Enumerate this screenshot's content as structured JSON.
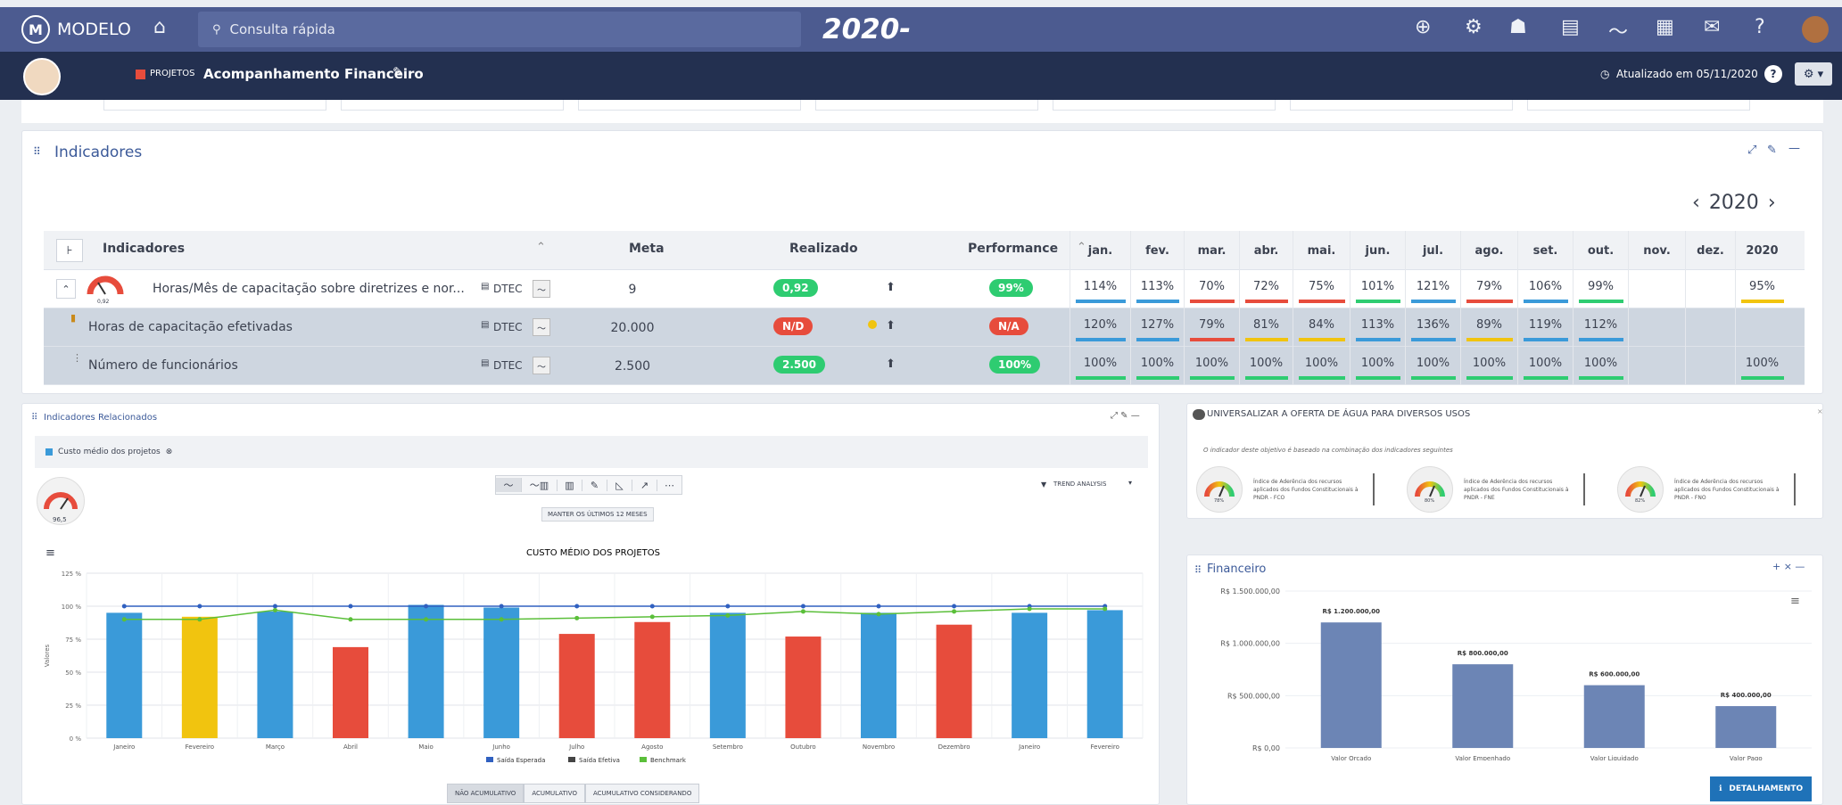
{
  "app": {
    "brand": "MODELO",
    "year_center": "2020-",
    "search_placeholder": "Consulta rápida"
  },
  "sub": {
    "badge": "PROJETOS",
    "title": "Acompanhamento Financeiro",
    "updated": "Atualizado em 05/11/2020"
  },
  "indicadores": {
    "title": "Indicadores",
    "year": "2020",
    "headers": {
      "ind": "Indicadores",
      "meta": "Meta",
      "real": "Realizado",
      "perf": "Performance"
    },
    "months": [
      "jan.",
      "fev.",
      "mar.",
      "abr.",
      "mai.",
      "jun.",
      "jul.",
      "ago.",
      "set.",
      "out.",
      "nov.",
      "dez.",
      "2020"
    ],
    "gauge_value": "0,92",
    "rows": [
      {
        "name": "Horas/Mês de capacitação sobre diretrizes e nor...",
        "dept": "DTEC",
        "meta": "9",
        "real": "0,92",
        "perf": "99%",
        "vals": [
          "114%",
          "113%",
          "70%",
          "72%",
          "75%",
          "101%",
          "121%",
          "79%",
          "106%",
          "99%",
          "",
          "",
          "95%"
        ],
        "colors": [
          "blue",
          "blue",
          "red",
          "red",
          "red",
          "green",
          "blue",
          "red",
          "blue",
          "green",
          "",
          "",
          "yellow"
        ]
      },
      {
        "name": "Horas de capacitação efetivadas",
        "dept": "DTEC",
        "meta": "20.000",
        "real": "N/D",
        "perf": "N/A",
        "vals": [
          "120%",
          "127%",
          "79%",
          "81%",
          "84%",
          "113%",
          "136%",
          "89%",
          "119%",
          "112%",
          "",
          "",
          ""
        ],
        "colors": [
          "blue",
          "blue",
          "red",
          "yellow",
          "yellow",
          "blue",
          "blue",
          "yellow",
          "blue",
          "blue",
          "",
          "",
          ""
        ]
      },
      {
        "name": "Número de funcionários",
        "dept": "DTEC",
        "meta": "2.500",
        "real": "2.500",
        "perf": "100%",
        "vals": [
          "100%",
          "100%",
          "100%",
          "100%",
          "100%",
          "100%",
          "100%",
          "100%",
          "100%",
          "100%",
          "",
          "",
          "100%"
        ],
        "colors": [
          "green",
          "green",
          "green",
          "green",
          "green",
          "green",
          "green",
          "green",
          "green",
          "green",
          "",
          "",
          "green"
        ]
      }
    ]
  },
  "rel": {
    "title": "Indicadores Relacionados",
    "filter": "Custo médio dos projetos",
    "gauge": "96,5",
    "series_btn": "MANTER OS ÚLTIMOS 12 MESES",
    "trend": "TREND ANALYSIS",
    "modes": [
      "NÃO ACUMULATIVO",
      "ACUMULATIVO",
      "ACUMULATIVO CONSIDERANDO"
    ]
  },
  "chart_data": [
    {
      "type": "bar",
      "title": "CUSTO MÉDIO DOS PROJETOS",
      "ylabel": "Valores",
      "ylim": [
        0,
        125
      ],
      "yticks": [
        "0 %",
        "25 %",
        "50 %",
        "75 %",
        "100 %",
        "125 %"
      ],
      "categories": [
        "Janeiro",
        "Fevereiro",
        "Março",
        "Abril",
        "Maio",
        "Junho",
        "Julho",
        "Agosto",
        "Setembro",
        "Outubro",
        "Novembro",
        "Dezembro",
        "Janeiro",
        "Fevereiro"
      ],
      "series": [
        {
          "name": "Saída Esperada",
          "type": "line",
          "color": "#3060c0",
          "values": [
            100,
            100,
            100,
            100,
            100,
            100,
            100,
            100,
            100,
            100,
            100,
            100,
            100,
            100
          ]
        },
        {
          "name": "Saída Efetiva",
          "type": "bar",
          "values": [
            95,
            92,
            96,
            69,
            101,
            99,
            79,
            88,
            95,
            77,
            95,
            86,
            95,
            97
          ],
          "colors": [
            "#3a9ad9",
            "#f1c40f",
            "#3a9ad9",
            "#e74c3c",
            "#3a9ad9",
            "#3a9ad9",
            "#e74c3c",
            "#e74c3c",
            "#3a9ad9",
            "#e74c3c",
            "#3a9ad9",
            "#e74c3c",
            "#3a9ad9",
            "#3a9ad9"
          ]
        },
        {
          "name": "Benchmark",
          "type": "line",
          "color": "#5bbf3a",
          "values": [
            90,
            90,
            97,
            90,
            90,
            90,
            91,
            92,
            93,
            96,
            94,
            96,
            98,
            98
          ]
        }
      ]
    },
    {
      "type": "bar",
      "title": "Financeiro",
      "ylim": [
        0,
        1500000
      ],
      "yticks": [
        "R$ 0,00",
        "R$ 500.000,00",
        "R$ 1.000.000,00",
        "R$ 1.500.000,00"
      ],
      "categories": [
        "Valor Orçado",
        "Valor Empenhado",
        "Valor Liquidado",
        "Valor Pago"
      ],
      "values": [
        1200000,
        800000,
        600000,
        400000
      ],
      "labels": [
        "R$ 1.200.000,00",
        "R$ 800.000,00",
        "R$ 600.000,00",
        "R$ 400.000,00"
      ]
    }
  ],
  "univ": {
    "title": "UNIVERSALIZAR A OFERTA DE ÁGUA PARA DIVERSOS USOS",
    "note": "O indicador deste objetivo é baseado na combinação dos indicadores seguintes",
    "items": [
      {
        "g": "78%",
        "t": "Índice de Aderência dos recursos aplicados dos Fundos Constitucionais à PNDR - FCO"
      },
      {
        "g": "80%",
        "t": "Índice de Aderência dos recursos aplicados dos Fundos Constitucionais à PNDR - FNE"
      },
      {
        "g": "82%",
        "t": "Índice de Aderência dos recursos aplicados dos Fundos Constitucionais à PNDR - FNO"
      }
    ]
  },
  "fin": {
    "title": "Financeiro",
    "detail": "DETALHAMENTO"
  }
}
